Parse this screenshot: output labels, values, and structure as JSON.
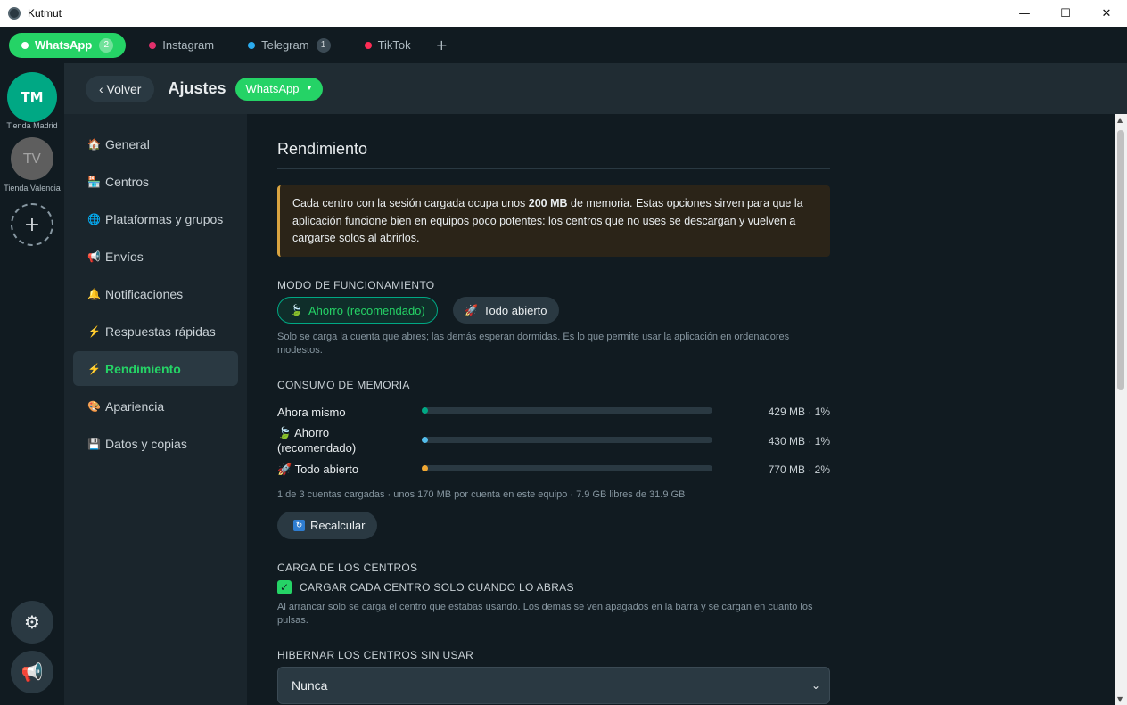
{
  "window": {
    "title": "Kutmut",
    "minimize": "—",
    "maximize": "☐",
    "close": "✕"
  },
  "tabs": [
    {
      "label": "WhatsApp",
      "badge": "2",
      "color": "#25d366"
    },
    {
      "label": "Instagram",
      "badge": "",
      "color": "#e1306c"
    },
    {
      "label": "Telegram",
      "badge": "1",
      "color": "#2aabee"
    },
    {
      "label": "TikTok",
      "badge": "",
      "color": "#fe2c55"
    }
  ],
  "tab_add": "+",
  "rail": {
    "accounts": [
      {
        "initials": "TM",
        "name": "Tienda Madrid",
        "color": "#00a884"
      },
      {
        "initials": "TV",
        "name": "Tienda Valencia",
        "color": "#6b6b6b"
      }
    ],
    "add": "+",
    "settings_icon": "⚙",
    "announce_icon": "📢"
  },
  "header": {
    "back_label": "‹ Volver",
    "title": "Ajustes",
    "platform": "WhatsApp",
    "caret": "▼"
  },
  "nav": [
    {
      "icon": "🏠",
      "label": "General"
    },
    {
      "icon": "🏪",
      "label": "Centros"
    },
    {
      "icon": "🌐",
      "label": "Plataformas y grupos"
    },
    {
      "icon": "📢",
      "label": "Envíos"
    },
    {
      "icon": "🔔",
      "label": "Notificaciones"
    },
    {
      "icon": "⚡",
      "label": "Respuestas rápidas"
    },
    {
      "icon": "⚡",
      "label": "Rendimiento"
    },
    {
      "icon": "🎨",
      "label": "Apariencia"
    },
    {
      "icon": "💾",
      "label": "Datos y copias"
    }
  ],
  "content": {
    "section_title": "Rendimiento",
    "info": {
      "part1": "Cada centro con la sesión cargada ocupa unos ",
      "bold": "200 MB",
      "part2": " de memoria. Estas opciones sirven para que la aplicación funcione bien en equipos poco potentes: los centros que no uses se descargan y vuelven a cargarse solos al abrirlos."
    },
    "mode": {
      "label": "MODO DE FUNCIONAMIENTO",
      "options": [
        {
          "icon": "🍃",
          "label": "Ahorro (recomendado)",
          "selected": true
        },
        {
          "icon": "🚀",
          "label": "Todo abierto",
          "selected": false
        }
      ],
      "hint": "Solo se carga la cuenta que abres; las demás esperan dormidas. Es lo que permite usar la aplicación en ordenadores modestos."
    },
    "memory": {
      "label": "CONSUMO DE MEMORIA",
      "rows": [
        {
          "icon": "",
          "name": "Ahora mismo",
          "value": "429 MB · 1%",
          "percent": 1,
          "color": "#00a884"
        },
        {
          "icon": "🍃",
          "name": "Ahorro (recomendado)",
          "value": "430 MB · 1%",
          "percent": 1,
          "color": "#53bdeb"
        },
        {
          "icon": "🚀",
          "name": "Todo abierto",
          "value": "770 MB · 2%",
          "percent": 2,
          "color": "#f0a732"
        }
      ],
      "summary": "1 de 3 cuentas cargadas · unos 170 MB por cuenta en este equipo · 7.9 GB libres de 31.9 GB",
      "recalc_icon": "🔄",
      "recalc_label": "Recalcular"
    },
    "load": {
      "label": "CARGA DE LOS CENTROS",
      "checkbox_label": "CARGAR CADA CENTRO SOLO CUANDO LO ABRAS",
      "checked": true,
      "hint": "Al arrancar solo se carga el centro que estabas usando. Los demás se ven apagados en la barra y se cargan en cuanto los pulsas."
    },
    "hibernate": {
      "label": "HIBERNAR LOS CENTROS SIN USAR",
      "value": "Nunca"
    }
  }
}
